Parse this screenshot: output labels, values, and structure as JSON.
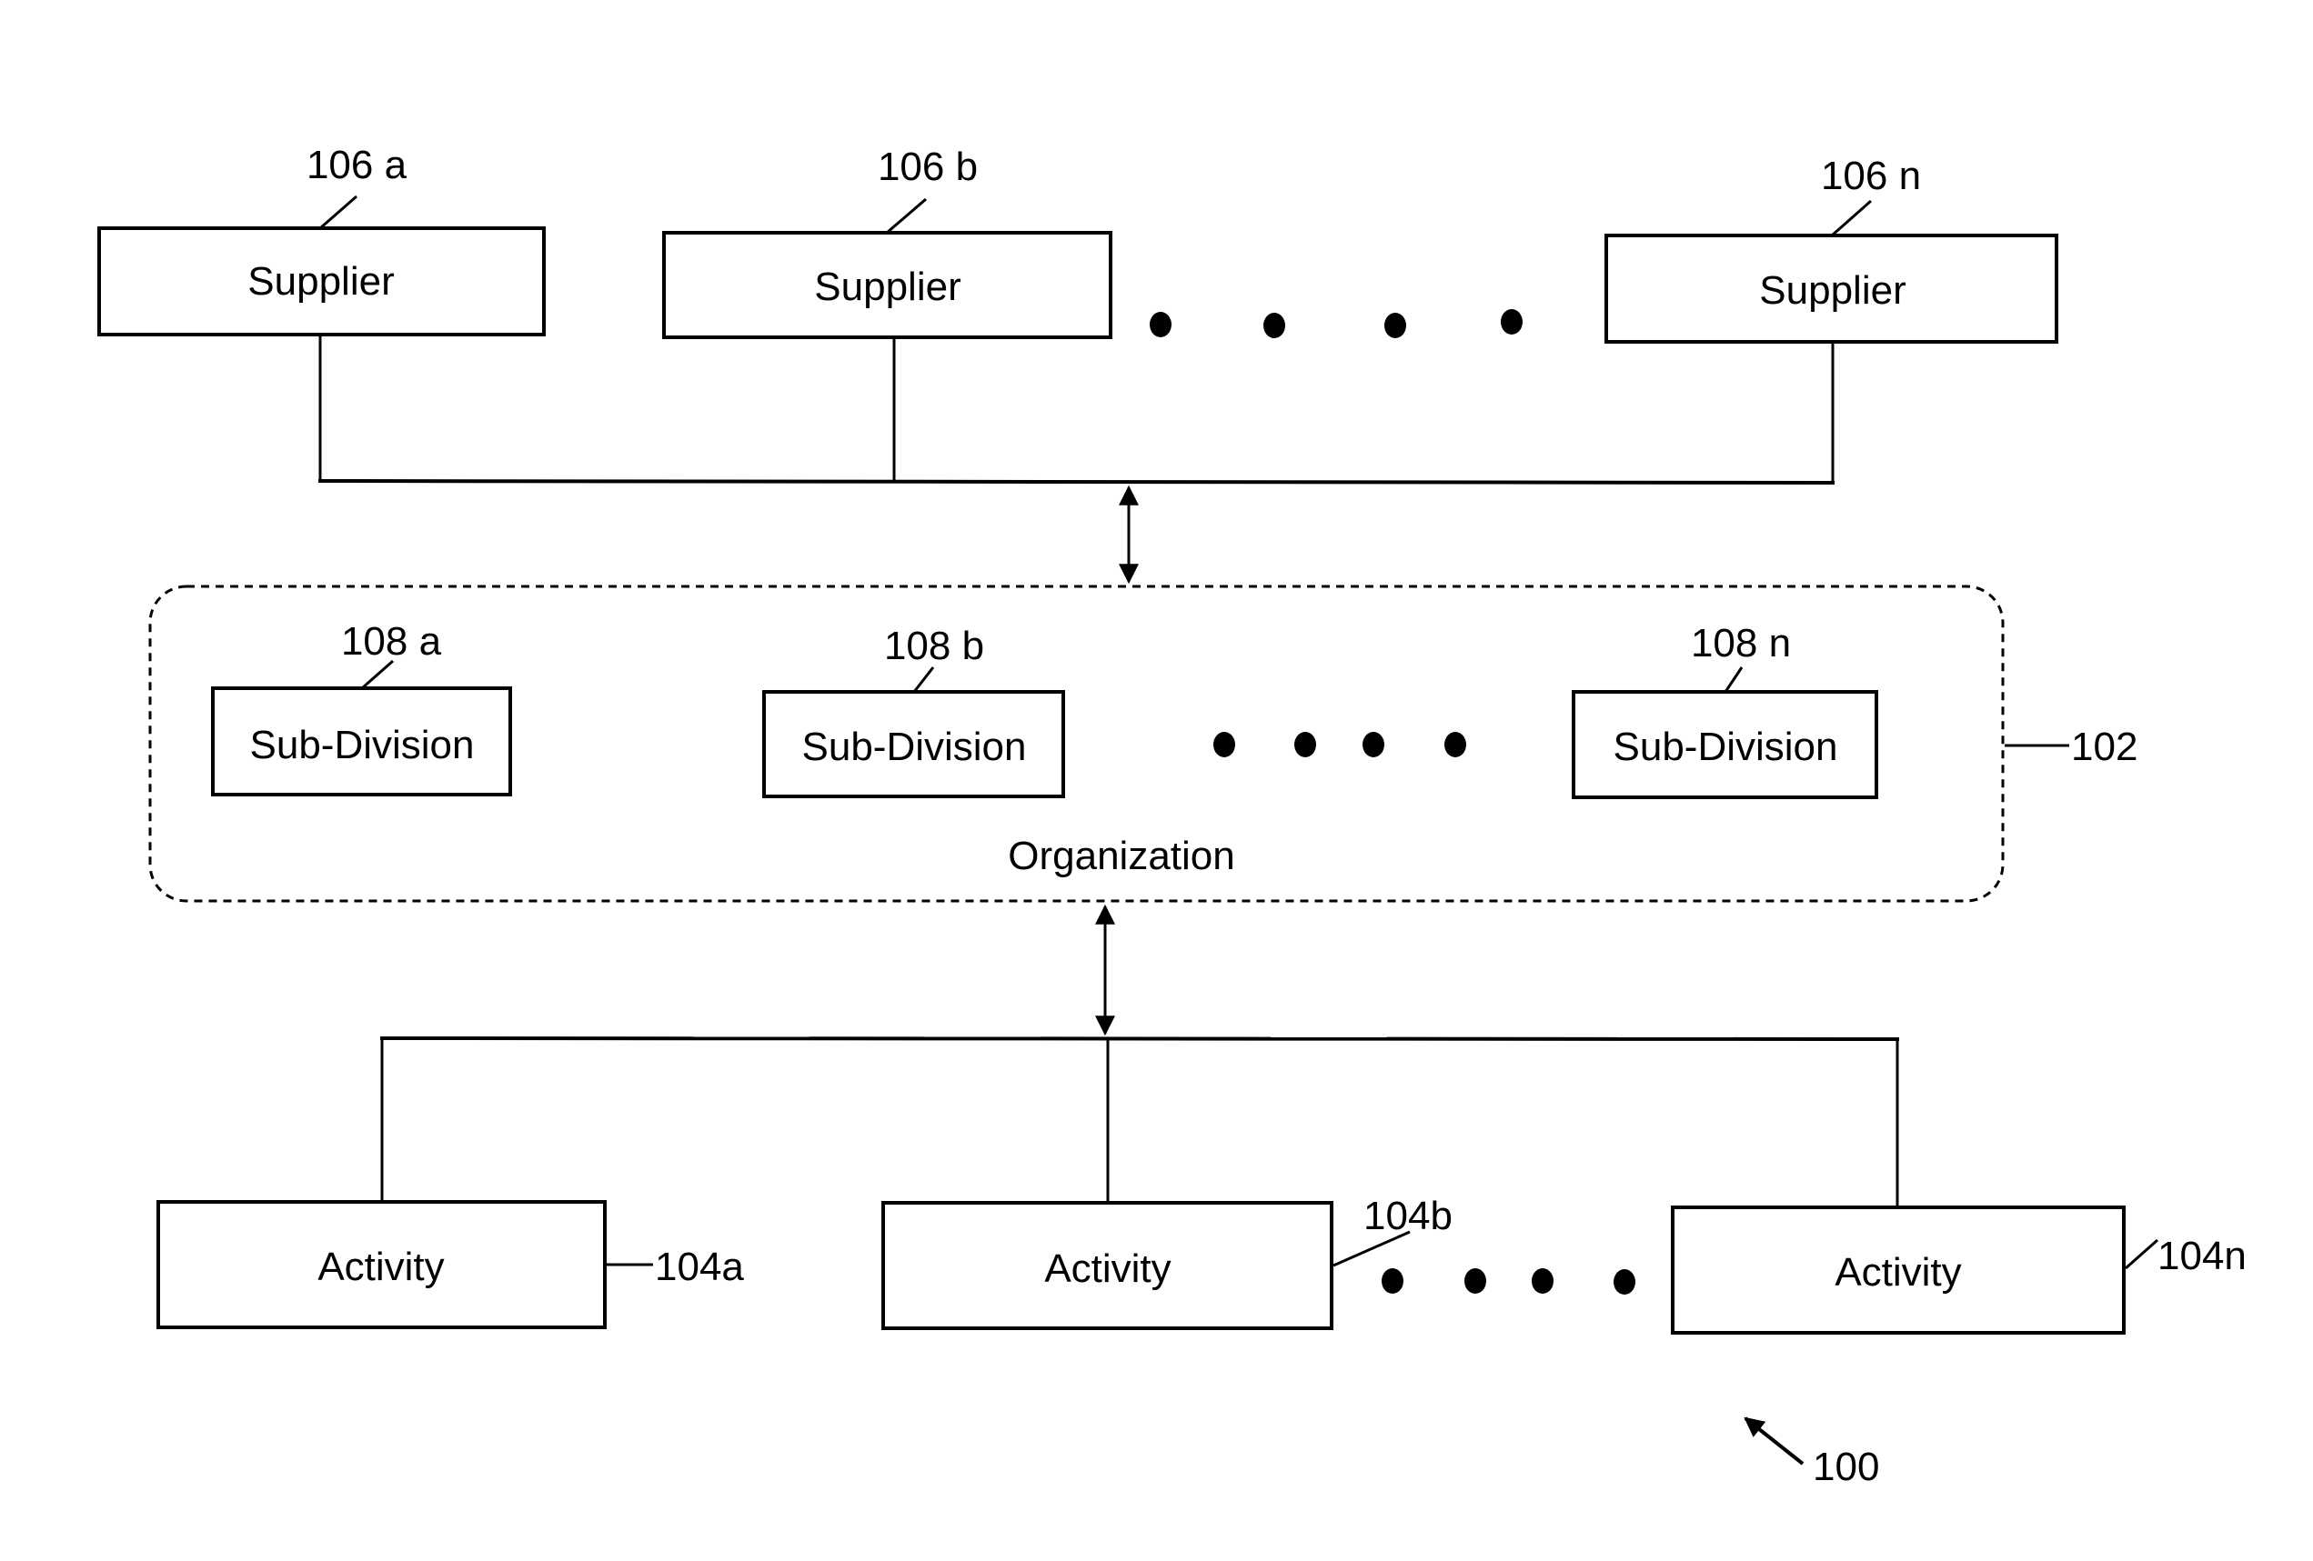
{
  "figure": {
    "reference": "100",
    "suppliers": [
      {
        "label": "Supplier",
        "ref": "106 a"
      },
      {
        "label": "Supplier",
        "ref": "106 b"
      },
      {
        "label": "Supplier",
        "ref": "106 n"
      }
    ],
    "organization": {
      "label": "Organization",
      "ref": "102",
      "subdivisions": [
        {
          "label": "Sub-Division",
          "ref": "108 a"
        },
        {
          "label": "Sub-Division",
          "ref": "108 b"
        },
        {
          "label": "Sub-Division",
          "ref": "108 n"
        }
      ]
    },
    "activities": [
      {
        "label": "Activity",
        "ref": "104a"
      },
      {
        "label": "Activity",
        "ref": "104b"
      },
      {
        "label": "Activity",
        "ref": "104n"
      }
    ],
    "ellipsis_dot_count": 4,
    "connections": [
      {
        "from": "suppliers",
        "to": "organization",
        "type": "bidirectional"
      },
      {
        "from": "organization",
        "to": "activities",
        "type": "bidirectional"
      }
    ]
  }
}
